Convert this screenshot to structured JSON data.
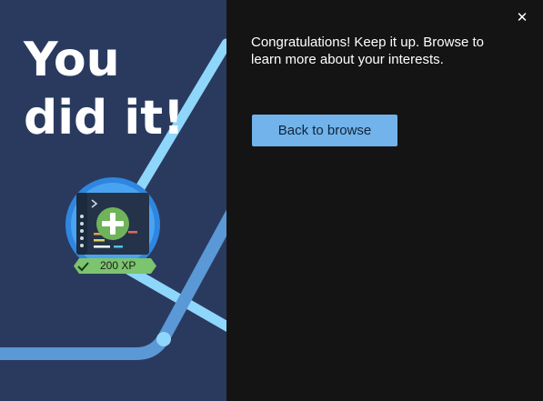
{
  "hero": {
    "line1": "You",
    "line2": "did it!"
  },
  "badge": {
    "xp": "200 XP",
    "icon": "terminal-plus-icon",
    "check_icon": "checkmark-icon"
  },
  "message": "Congratulations! Keep it up. Browse to learn more about your interests.",
  "actions": {
    "back_label": "Back to browse",
    "close_glyph": "✕"
  },
  "colors": {
    "left_bg": "#2a3a5f",
    "right_bg": "#141414",
    "accent": "#71b3ea",
    "badge_ring": "#2f86e0",
    "xp_green": "#7cc46e"
  }
}
